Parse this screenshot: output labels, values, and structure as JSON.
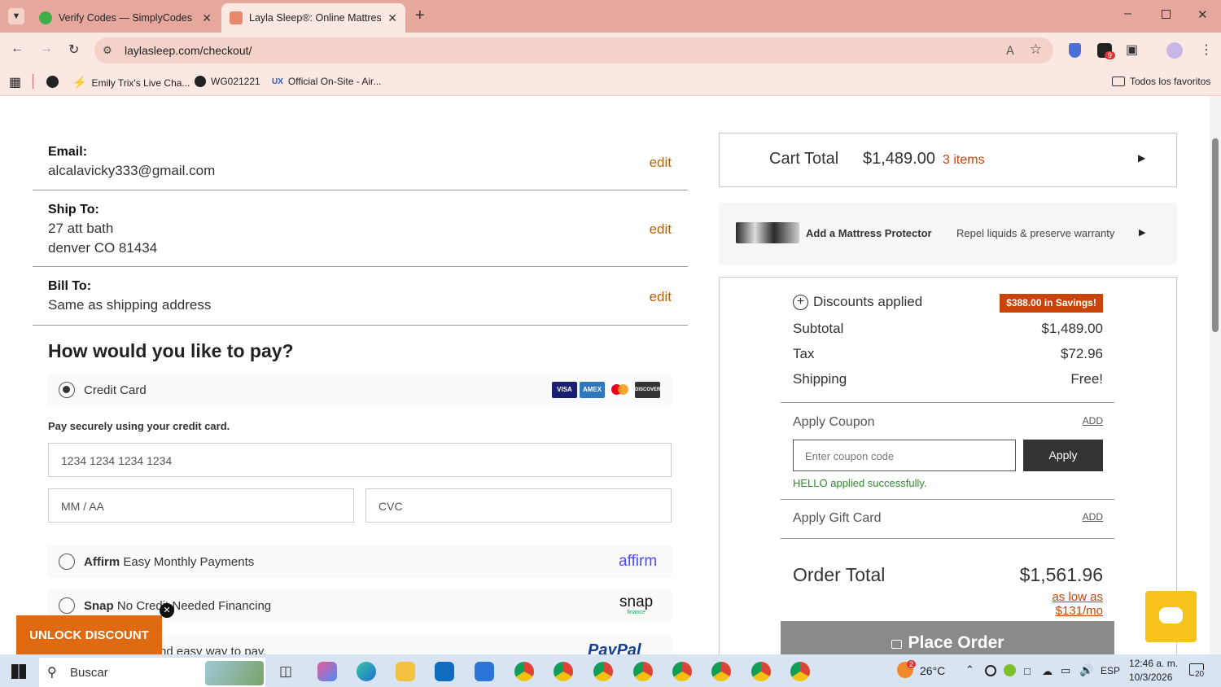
{
  "browser": {
    "tabs": [
      {
        "title": "Verify Codes — SimplyCodes",
        "active": false
      },
      {
        "title": "Layla Sleep®: Online Mattress S",
        "active": true
      }
    ],
    "url": "laylasleep.com/checkout/",
    "ext_badge": "9",
    "bookmarks": [
      {
        "label": "Emily Trix's Live Cha..."
      },
      {
        "label": "WG021221"
      },
      {
        "label": "Official On-Site - Air..."
      }
    ],
    "all_bookmarks": "Todos los favoritos"
  },
  "checkout": {
    "email_label": "Email:",
    "email_value": "alcalavicky333@gmail.com",
    "ship_label": "Ship To:",
    "ship_line1": "27 att bath",
    "ship_line2": "denver CO 81434",
    "bill_label": "Bill To:",
    "bill_value": "Same as shipping address",
    "edit_label": "edit",
    "pay_heading": "How would you like to pay?",
    "credit_card_label": "Credit Card",
    "card_brands": [
      "VISA",
      "AMEX",
      "MC",
      "DISCOVER"
    ],
    "pay_securely": "Pay securely using your credit card.",
    "card_number_placeholder": "1234 1234 1234 1234",
    "expiry_placeholder": "MM / AA",
    "cvc_placeholder": "CVC",
    "affirm_bold": "Affirm",
    "affirm_text": "Easy Monthly Payments",
    "affirm_logo": "affirm",
    "snap_bold": "Snap",
    "snap_text": "No Credit Needed Financing",
    "snap_logo": "snap",
    "snap_logo_sub": "finance",
    "paypal_text": "nd easy way to pay.",
    "paypal_logo": "PayPal",
    "unlock_discount": "UNLOCK DISCOUNT"
  },
  "summary": {
    "cart_total_label": "Cart Total",
    "cart_total_value": "$1,489.00",
    "cart_items": "3 items",
    "protector_title": "Add a Mattress Protector",
    "protector_desc": "Repel liquids & preserve warranty",
    "discounts_label": "Discounts applied",
    "savings_badge": "$388.00 in Savings!",
    "subtotal_label": "Subtotal",
    "subtotal_value": "$1,489.00",
    "tax_label": "Tax",
    "tax_value": "$72.96",
    "shipping_label": "Shipping",
    "shipping_value": "Free!",
    "coupon_label": "Apply Coupon",
    "add_label": "ADD",
    "coupon_placeholder": "Enter coupon code",
    "apply_label": "Apply",
    "coupon_success": "HELLO applied successfully.",
    "giftcard_label": "Apply Gift Card",
    "order_total_label": "Order Total",
    "order_total_value": "$1,561.96",
    "monthly": "as low as $131/mo",
    "place_order": "Place Order"
  },
  "taskbar": {
    "search": "Buscar",
    "weather_temp": "26°C",
    "weather_badge": "2",
    "lang": "ESP",
    "time": "12:46 a. m.",
    "date": "10/3/2026",
    "notif_count": "20"
  },
  "colors": {
    "accent_orange": "#b8620a",
    "savings_bg": "#c8440a",
    "place_order_bg": "#8a8a8a",
    "chat_bubble": "#f7c21a",
    "unlock_bg": "#e06a12"
  }
}
